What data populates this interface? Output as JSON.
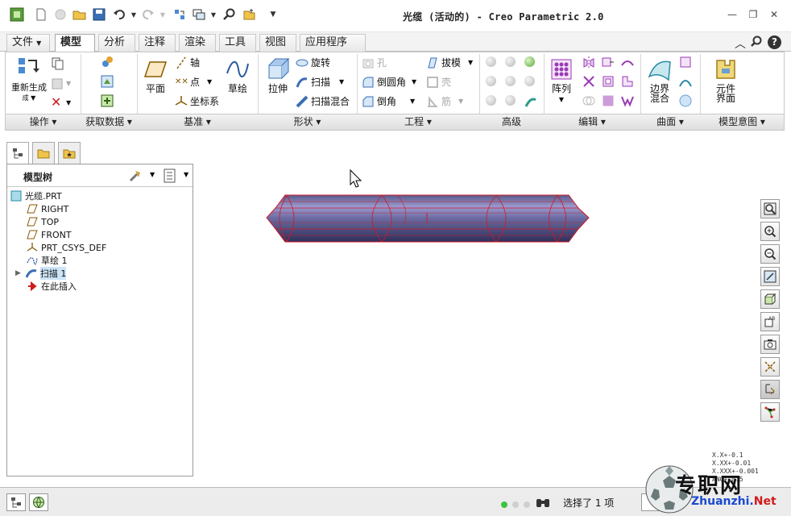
{
  "window": {
    "title": "光缆 (活动的) - Creo Parametric 2.0"
  },
  "quick_access": [
    "app-logo-icon",
    "new-icon",
    "open-icon",
    "save-icon",
    "undo-icon",
    "redo-icon",
    "regenerate-icon",
    "windows-icon",
    "find-icon",
    "close-window-icon",
    "customize-icon"
  ],
  "tabs": [
    {
      "label": "文件",
      "has_arrow": true
    },
    {
      "label": "模型",
      "active": true
    },
    {
      "label": "分析"
    },
    {
      "label": "注释"
    },
    {
      "label": "渲染"
    },
    {
      "label": "工具"
    },
    {
      "label": "视图"
    },
    {
      "label": "应用程序"
    }
  ],
  "ribbon": {
    "groups": [
      {
        "label": "操作"
      },
      {
        "label": "获取数据"
      },
      {
        "label": "基准"
      },
      {
        "label": "形状"
      },
      {
        "label": "工程"
      },
      {
        "label": "高级"
      },
      {
        "label": "编辑"
      },
      {
        "label": "曲面"
      },
      {
        "label": "模型意图"
      }
    ],
    "operations": {
      "regenerate": "重新生成"
    },
    "datum": {
      "plane": "平面",
      "axis": "轴",
      "point": "点",
      "csys": "坐标系",
      "sketch": "草绘"
    },
    "shape": {
      "extrude": "拉伸",
      "revolve": "旋转",
      "sweep": "扫描",
      "swept_blend": "扫描混合"
    },
    "engineering": {
      "hole": "孔",
      "draft": "拔模",
      "round": "倒圆角",
      "shell": "壳",
      "chamfer": "倒角",
      "rib": "筋"
    },
    "editing": {
      "pattern": "阵列"
    },
    "surfaces": {
      "boundary_blend": "边界混合"
    },
    "model_intent": {
      "component_interface": "元件界面"
    }
  },
  "model_tree": {
    "title": "模型树",
    "items": [
      {
        "label": "光缆.PRT",
        "icon": "part-icon"
      },
      {
        "label": "RIGHT",
        "icon": "datum-plane-icon"
      },
      {
        "label": "TOP",
        "icon": "datum-plane-icon"
      },
      {
        "label": "FRONT",
        "icon": "datum-plane-icon"
      },
      {
        "label": "PRT_CSYS_DEF",
        "icon": "csys-icon"
      },
      {
        "label": "草绘 1",
        "icon": "sketch-icon"
      },
      {
        "label": "扫描 1",
        "icon": "sweep-icon",
        "selected": true
      },
      {
        "label": "在此插入",
        "icon": "insert-here-icon"
      }
    ]
  },
  "status": {
    "selected": "选择了 1 项"
  },
  "tolerance": [
    "X.X+-0.1",
    "X.XX+-0.01",
    "X.XXX+-0.001",
    "ANG+-0.5"
  ],
  "watermark": {
    "text": "专职网",
    "url": "Zhuanzhi.Net"
  }
}
